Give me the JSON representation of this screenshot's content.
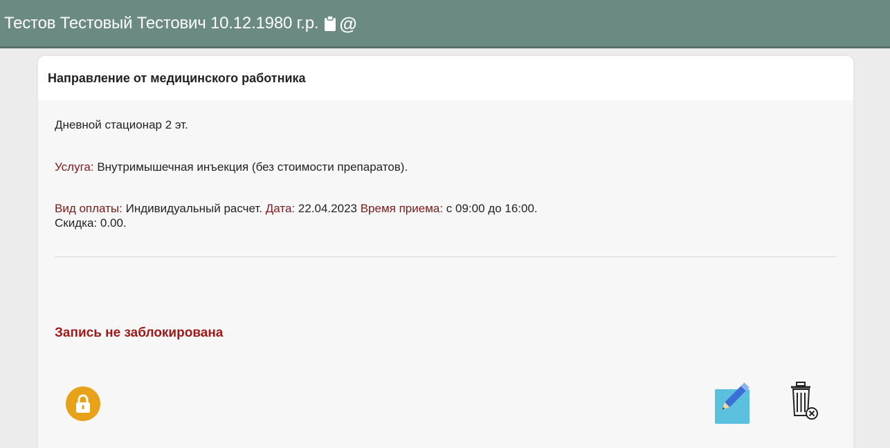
{
  "header": {
    "patient": "Тестов Тестовый Тестович 10.12.1980 г.р.",
    "icons": [
      "clipboard-icon",
      "at-sign-icon"
    ]
  },
  "card": {
    "title": "Направление от медицинского работника",
    "department": "Дневной стационар 2 эт.",
    "service_label": "Услуга:",
    "service_value": "Внутримышечная инъекция (без стоимости препаратов).",
    "payment_label": "Вид оплаты:",
    "payment_value": "Индивидуальный расчет.",
    "date_label": "Дата:",
    "date_value": "22.04.2023",
    "time_label": "Время приема:",
    "time_value": "с 09:00 до 16:00.",
    "discount_label": "Скидка:",
    "discount_value": "0.00.",
    "lock_status": "Запись не заблокирована"
  },
  "actions": {
    "icons": [
      "lock-icon",
      "edit-icon",
      "trash-icon"
    ]
  },
  "colors": {
    "header_bg": "#6a8a82",
    "label": "#7a1a1a",
    "lock_status": "#a01a1a",
    "lock_button": "#e8a21a",
    "edit_button": "#5bc0de"
  }
}
